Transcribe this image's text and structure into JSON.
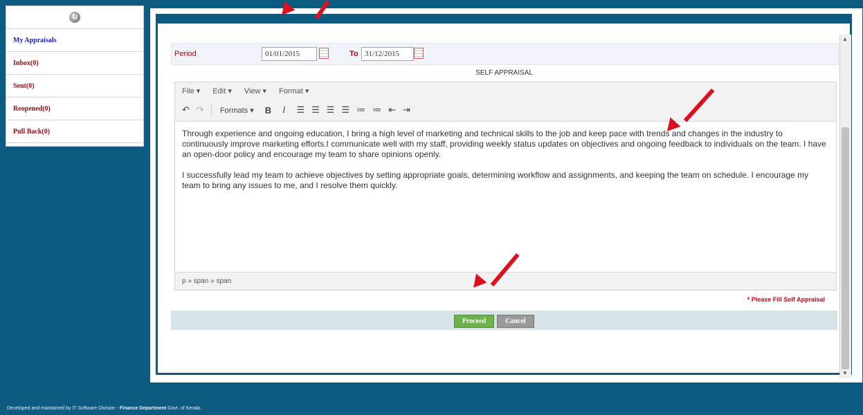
{
  "sidebar": {
    "refresh_icon": "refresh-icon",
    "items": [
      {
        "label": "My Appraisals"
      },
      {
        "label": "Inbox(0)"
      },
      {
        "label": "Sent(0)"
      },
      {
        "label": "Reopened(0)"
      },
      {
        "label": "Pull Back(0)"
      }
    ]
  },
  "period": {
    "label": "Period",
    "from": "01/01/2015",
    "to_label": "To",
    "to": "31/12/2015"
  },
  "form": {
    "title": "SELF APPRAISAL",
    "menu": [
      "File ▾",
      "Edit ▾",
      "View ▾",
      "Format ▾"
    ],
    "formats_label": "Formats ▾",
    "content": [
      "Through experience and ongoing education, I bring a high level of marketing and technical skills to the job and keep pace with trends and changes in the industry to continuously improve marketing efforts.I communicate well with my staff, providing weekly status updates on objectives and ongoing feedback to individuals on the team. I have an open-door policy and encourage my team to share opinions openly.",
      "I successfully lead my team to achieve objectives by setting appropriate goals, determining workflow and assignments, and keeping the team on schedule. I encourage my team to bring any issues to me, and I resolve them quickly."
    ],
    "status_path": "p » span » span",
    "warning": "* Please Fill Self Appraisal",
    "proceed": "Proceed",
    "cancel": "Cancel"
  },
  "footer": {
    "prefix": "Developed and maintained by IT Software Division - ",
    "dept": "Finance Department",
    "suffix": " Govt. of Kerala."
  },
  "colors": {
    "brand": "#0d5a80",
    "red": "#d8121e",
    "proceed": "#6db24a"
  }
}
